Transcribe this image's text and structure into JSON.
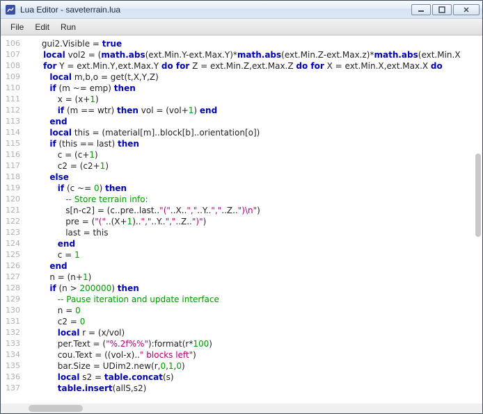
{
  "window": {
    "title": "Lua Editor - saveterrain.lua"
  },
  "menu": {
    "file": "File",
    "edit": "Edit",
    "run": "Run"
  },
  "lines": [
    {
      "n": 106,
      "tokens": [
        [
          "pl",
          "      gui2.Visible = "
        ],
        [
          "kw",
          "true"
        ]
      ]
    },
    {
      "n": 107,
      "tokens": [
        [
          "kw",
          "      local"
        ],
        [
          "pl",
          " vol2 = ("
        ],
        [
          "kw",
          "math.abs"
        ],
        [
          "pl",
          "(ext.Min.Y-ext.Max.Y)*"
        ],
        [
          "kw",
          "math.abs"
        ],
        [
          "pl",
          "(ext.Min.Z-ext.Max.z)*"
        ],
        [
          "kw",
          "math.abs"
        ],
        [
          "pl",
          "(ext.Min.X"
        ]
      ]
    },
    {
      "n": 108,
      "tokens": [
        [
          "kw",
          "      for"
        ],
        [
          "pl",
          " Y = ext.Min.Y,ext.Max.Y "
        ],
        [
          "kw",
          "do for"
        ],
        [
          "pl",
          " Z = ext.Min.Z,ext.Max.Z "
        ],
        [
          "kw",
          "do for"
        ],
        [
          "pl",
          " X = ext.Min.X,ext.Max.X "
        ],
        [
          "kw",
          "do"
        ]
      ]
    },
    {
      "n": 109,
      "tokens": [
        [
          "pl",
          "         "
        ],
        [
          "kw",
          "local"
        ],
        [
          "pl",
          " m,b,o = get(t,X,Y,Z)"
        ]
      ]
    },
    {
      "n": 110,
      "tokens": [
        [
          "pl",
          "         "
        ],
        [
          "kw",
          "if"
        ],
        [
          "pl",
          " (m ~= emp) "
        ],
        [
          "kw",
          "then"
        ]
      ]
    },
    {
      "n": 111,
      "tokens": [
        [
          "pl",
          "            x = (x+"
        ],
        [
          "num",
          "1"
        ],
        [
          "pl",
          ")"
        ]
      ]
    },
    {
      "n": 112,
      "tokens": [
        [
          "pl",
          "            "
        ],
        [
          "kw",
          "if"
        ],
        [
          "pl",
          " (m == wtr) "
        ],
        [
          "kw",
          "then"
        ],
        [
          "pl",
          " vol = (vol+"
        ],
        [
          "num",
          "1"
        ],
        [
          "pl",
          ") "
        ],
        [
          "kw",
          "end"
        ]
      ]
    },
    {
      "n": 113,
      "tokens": [
        [
          "pl",
          "         "
        ],
        [
          "kw",
          "end"
        ]
      ]
    },
    {
      "n": 114,
      "tokens": [
        [
          "pl",
          "         "
        ],
        [
          "kw",
          "local"
        ],
        [
          "pl",
          " this = (material[m]..block[b]..orientation[o])"
        ]
      ]
    },
    {
      "n": 115,
      "tokens": [
        [
          "pl",
          "         "
        ],
        [
          "kw",
          "if"
        ],
        [
          "pl",
          " (this == last) "
        ],
        [
          "kw",
          "then"
        ]
      ]
    },
    {
      "n": 116,
      "tokens": [
        [
          "pl",
          "            c = (c+"
        ],
        [
          "num",
          "1"
        ],
        [
          "pl",
          ")"
        ]
      ]
    },
    {
      "n": 117,
      "tokens": [
        [
          "pl",
          "            c2 = (c2+"
        ],
        [
          "num",
          "1"
        ],
        [
          "pl",
          ")"
        ]
      ]
    },
    {
      "n": 118,
      "tokens": [
        [
          "pl",
          "         "
        ],
        [
          "kw",
          "else"
        ]
      ]
    },
    {
      "n": 119,
      "tokens": [
        [
          "pl",
          "            "
        ],
        [
          "kw",
          "if"
        ],
        [
          "pl",
          " (c ~= "
        ],
        [
          "num",
          "0"
        ],
        [
          "pl",
          ") "
        ],
        [
          "kw",
          "then"
        ]
      ]
    },
    {
      "n": 120,
      "tokens": [
        [
          "pl",
          "               "
        ],
        [
          "cm",
          "-- Store terrain info:"
        ]
      ]
    },
    {
      "n": 121,
      "tokens": [
        [
          "pl",
          "               s[n-c2] = (c..pre..last.."
        ],
        [
          "str",
          "\"(\""
        ],
        [
          "pl",
          "..X.."
        ],
        [
          "str",
          "\",\""
        ],
        [
          "pl",
          "..Y.."
        ],
        [
          "str",
          "\",\""
        ],
        [
          "pl",
          "..Z.."
        ],
        [
          "str",
          "\")\\n\""
        ],
        [
          "pl",
          ")"
        ]
      ]
    },
    {
      "n": 122,
      "tokens": [
        [
          "pl",
          "               pre = ("
        ],
        [
          "str",
          "\"(\""
        ],
        [
          "pl",
          "..(X+"
        ],
        [
          "num",
          "1"
        ],
        [
          "pl",
          ").."
        ],
        [
          "str",
          "\",\""
        ],
        [
          "pl",
          "..Y.."
        ],
        [
          "str",
          "\",\""
        ],
        [
          "pl",
          "..Z.."
        ],
        [
          "str",
          "\")\""
        ],
        [
          "pl",
          ")"
        ]
      ]
    },
    {
      "n": 123,
      "tokens": [
        [
          "pl",
          "               last = this"
        ]
      ]
    },
    {
      "n": 124,
      "tokens": [
        [
          "pl",
          "            "
        ],
        [
          "kw",
          "end"
        ]
      ]
    },
    {
      "n": 125,
      "tokens": [
        [
          "pl",
          "            c = "
        ],
        [
          "num",
          "1"
        ]
      ]
    },
    {
      "n": 126,
      "tokens": [
        [
          "pl",
          "         "
        ],
        [
          "kw",
          "end"
        ]
      ]
    },
    {
      "n": 127,
      "tokens": [
        [
          "pl",
          "         n = (n+"
        ],
        [
          "num",
          "1"
        ],
        [
          "pl",
          ")"
        ]
      ]
    },
    {
      "n": 128,
      "tokens": [
        [
          "pl",
          "         "
        ],
        [
          "kw",
          "if"
        ],
        [
          "pl",
          " (n > "
        ],
        [
          "num",
          "200000"
        ],
        [
          "pl",
          ") "
        ],
        [
          "kw",
          "then"
        ]
      ]
    },
    {
      "n": 129,
      "tokens": [
        [
          "pl",
          "            "
        ],
        [
          "cm",
          "-- Pause iteration and update interface"
        ]
      ]
    },
    {
      "n": 130,
      "tokens": [
        [
          "pl",
          "            n = "
        ],
        [
          "num",
          "0"
        ]
      ]
    },
    {
      "n": 131,
      "tokens": [
        [
          "pl",
          "            c2 = "
        ],
        [
          "num",
          "0"
        ]
      ]
    },
    {
      "n": 132,
      "tokens": [
        [
          "pl",
          "            "
        ],
        [
          "kw",
          "local"
        ],
        [
          "pl",
          " r = (x/vol)"
        ]
      ]
    },
    {
      "n": 133,
      "tokens": [
        [
          "pl",
          "            per.Text = ("
        ],
        [
          "str",
          "\"%.2f%%\""
        ],
        [
          "pl",
          "):format(r*"
        ],
        [
          "num",
          "100"
        ],
        [
          "pl",
          ")"
        ]
      ]
    },
    {
      "n": 134,
      "tokens": [
        [
          "pl",
          "            cou.Text = ((vol-x).."
        ],
        [
          "str",
          "\" blocks left\""
        ],
        [
          "pl",
          ")"
        ]
      ]
    },
    {
      "n": 135,
      "tokens": [
        [
          "pl",
          "            bar.Size = UDim2.new(r,"
        ],
        [
          "num",
          "0"
        ],
        [
          "pl",
          ","
        ],
        [
          "num",
          "1"
        ],
        [
          "pl",
          ","
        ],
        [
          "num",
          "0"
        ],
        [
          "pl",
          ")"
        ]
      ]
    },
    {
      "n": 136,
      "tokens": [
        [
          "pl",
          "            "
        ],
        [
          "kw",
          "local"
        ],
        [
          "pl",
          " s2 = "
        ],
        [
          "kw",
          "table.concat"
        ],
        [
          "pl",
          "(s)"
        ]
      ]
    },
    {
      "n": 137,
      "tokens": [
        [
          "pl",
          "            "
        ],
        [
          "kw",
          "table.insert"
        ],
        [
          "pl",
          "(allS,s2)"
        ]
      ]
    }
  ]
}
